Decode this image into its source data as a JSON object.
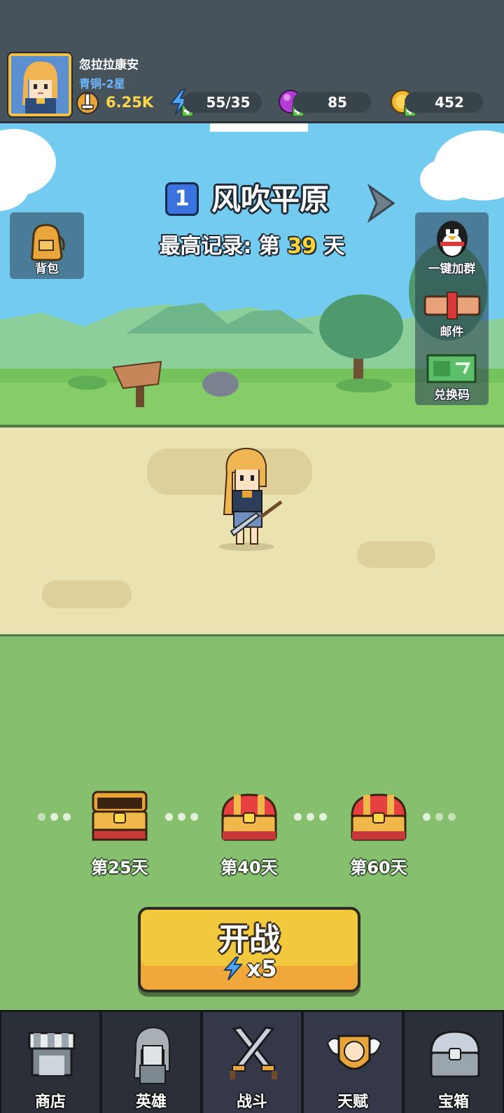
{
  "player": {
    "name": "忽拉拉康安",
    "rank": "青铜-2星",
    "power": "6.25K"
  },
  "resources": {
    "energy": "55/35",
    "gems": "85",
    "gold": "452"
  },
  "stage": {
    "number": "1",
    "name": "风吹平原",
    "record_prefix": "最高记录: 第",
    "record_day": "39",
    "record_suffix": "天"
  },
  "side_buttons": {
    "bag": "背包",
    "join_group": "一键加群",
    "mail": "邮件",
    "redeem_code": "兑换码"
  },
  "milestones": [
    {
      "label": "第25天",
      "state": "opened"
    },
    {
      "label": "第40天",
      "state": "closed"
    },
    {
      "label": "第60天",
      "state": "closed"
    }
  ],
  "start_button": {
    "label": "开战",
    "cost": "x5"
  },
  "nav": [
    {
      "label": "商店",
      "icon": "shop-icon"
    },
    {
      "label": "英雄",
      "icon": "hero-icon"
    },
    {
      "label": "战斗",
      "icon": "battle-icon",
      "active": true
    },
    {
      "label": "天赋",
      "icon": "talent-icon",
      "active": true
    },
    {
      "label": "宝箱",
      "icon": "chest-icon"
    }
  ],
  "colors": {
    "topbar": "#46535a",
    "sky": "#73cbef",
    "path": "#ebe2b2",
    "grass": "#86c06f",
    "accent_yellow": "#f2c93c",
    "nav_bg": "#2b2f37"
  }
}
